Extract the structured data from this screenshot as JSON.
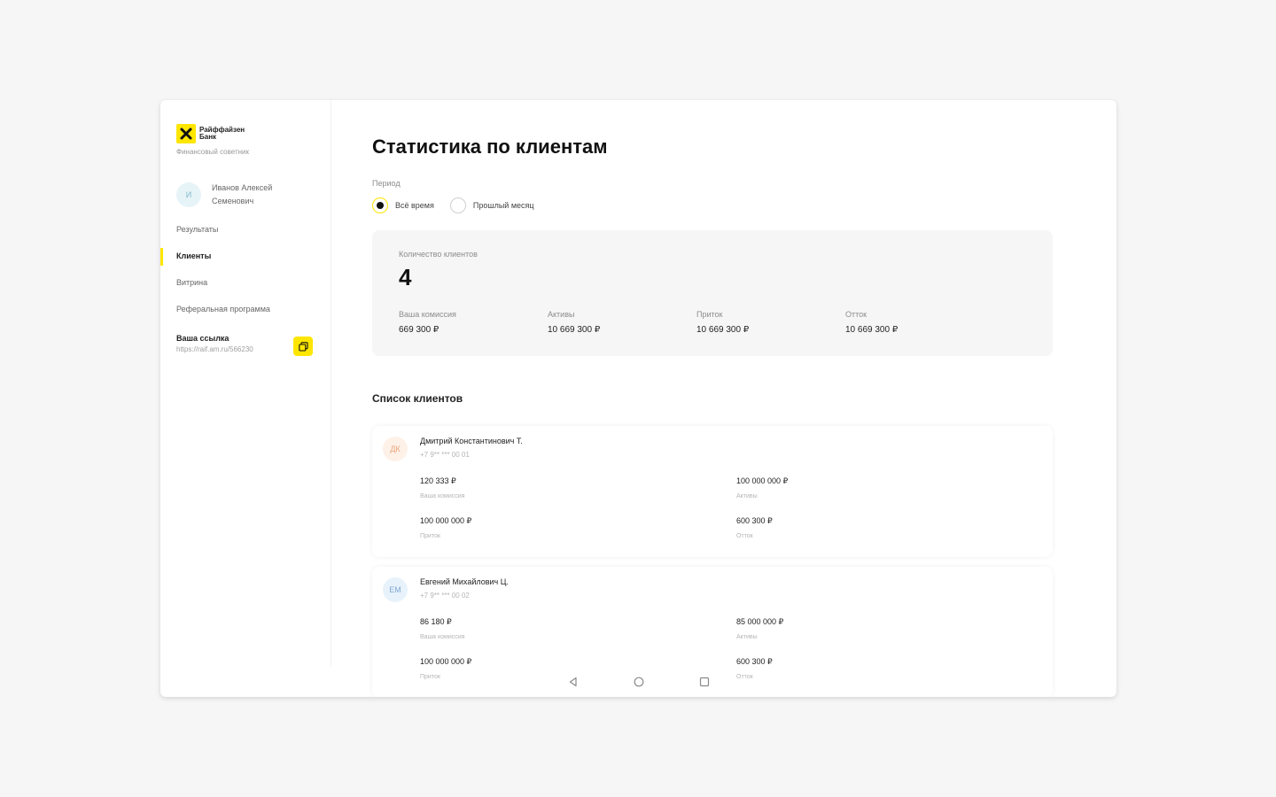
{
  "sidebar": {
    "logo_text": "Райффайзен Банк",
    "logo_sub": "Финансовый советник",
    "avatar_initials": "И",
    "profile_name": "Иванов Алексей Семенович",
    "nav": [
      {
        "label": "Результаты"
      },
      {
        "label": "Клиенты"
      },
      {
        "label": "Витрина"
      },
      {
        "label": "Реферальная программа"
      }
    ],
    "link_label": "Ваша ссылка",
    "link_url": "https://raif.am.ru/566230"
  },
  "main": {
    "title": "Статистика по клиентам",
    "period_label": "Период",
    "period_options": [
      {
        "label": "Всё время",
        "selected": true
      },
      {
        "label": "Прошлый месяц",
        "selected": false
      }
    ],
    "stats": {
      "count_label": "Количество клиентов",
      "count": "4",
      "cols": [
        {
          "label": "Ваша комиссия",
          "value": "669 300 ₽"
        },
        {
          "label": "Активы",
          "value": "10 669 300 ₽"
        },
        {
          "label": "Приток",
          "value": "10 669 300 ₽"
        },
        {
          "label": "Отток",
          "value": "10 669 300 ₽"
        }
      ]
    },
    "list_title": "Список клиентов",
    "clients": [
      {
        "initials": "ДК",
        "avatar_bg": "#fdf1e8",
        "avatar_fg": "#e8a57d",
        "name": "Дмитрий Константинович Т.",
        "phone": "+7 9** *** 00 01",
        "commission": "120 333 ₽",
        "commission_label": "Ваша комиссия",
        "assets": "100 000 000 ₽",
        "assets_label": "Активы",
        "inflow": "100 000 000 ₽",
        "inflow_label": "Приток",
        "outflow": "600 300 ₽",
        "outflow_label": "Отток"
      },
      {
        "initials": "ЕМ",
        "avatar_bg": "#e8f2fb",
        "avatar_fg": "#7fa9d3",
        "name": "Евгений Михайлович Ц.",
        "phone": "+7 9** *** 00 02",
        "commission": "86 180 ₽",
        "commission_label": "Ваша комиссия",
        "assets": "85 000 000 ₽",
        "assets_label": "Активы",
        "inflow": "100 000 000 ₽",
        "inflow_label": "Приток",
        "outflow": "600 300 ₽",
        "outflow_label": "Отток"
      }
    ]
  },
  "colors": {
    "accent": "#fee600",
    "panel": "#f6f6f6"
  }
}
